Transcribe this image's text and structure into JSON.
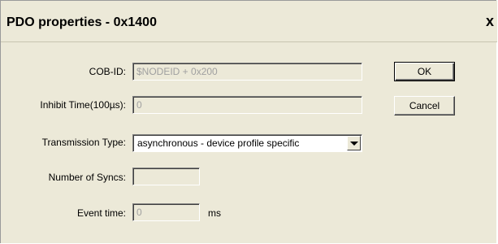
{
  "dialog": {
    "title": "PDO properties - 0x1400",
    "close_glyph": "x"
  },
  "fields": {
    "cob_id": {
      "label": "COB-ID:",
      "value": "$NODEID + 0x200"
    },
    "inhibit_time": {
      "label": "Inhibit Time(100µs):",
      "value": "0"
    },
    "transmission_type": {
      "label": "Transmission Type:",
      "value": "asynchronous - device profile specific"
    },
    "number_of_syncs": {
      "label": "Number of Syncs:",
      "value": ""
    },
    "event_time": {
      "label": "Event time:",
      "value": "0",
      "unit": "ms"
    }
  },
  "buttons": {
    "ok": "OK",
    "cancel": "Cancel"
  },
  "icons": {
    "close": "close-icon",
    "dropdown": "chevron-down-icon"
  }
}
